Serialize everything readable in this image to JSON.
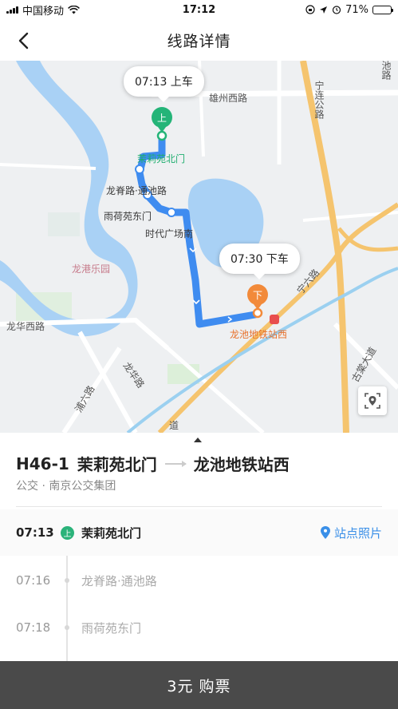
{
  "status_bar": {
    "carrier": "中国移动",
    "time": "17:12",
    "battery": "71%",
    "battery_level": 0.71
  },
  "nav": {
    "title": "线路详情",
    "back_icon": "chevron-left-icon"
  },
  "map": {
    "board_bubble": "07:13 上车",
    "alight_bubble": "07:30 下车",
    "board_pin": "上",
    "alight_pin": "下",
    "labels": {
      "xiongzhou_road": "雄州西路",
      "ninglian_road": "宁连公路",
      "chi_top": "池路",
      "molly_north_gate": "茉莉苑北门",
      "longji_tongchi": "龙脊路·通池路",
      "yuhe_east": "雨荷苑东门",
      "shidai_south": "时代广场南",
      "longgang_park": "龙港乐园",
      "ningliu_road": "宁六路",
      "longhua_west": "龙华西路",
      "longchi_station": "龙池地铁站西",
      "longhua_road": "龙华路",
      "puliu_road": "浦六路",
      "gutang_avenue": "古棠大道",
      "dao": "道"
    },
    "route_color": "#3f8cf0",
    "locate_icon": "locate-icon"
  },
  "sheet": {
    "route_number": "H46-1",
    "from": "茉莉苑北门",
    "to": "龙池地铁站西",
    "subtitle": "公交 · 南京公交集团",
    "photo_link": "站点照片",
    "stops": [
      {
        "time": "07:13",
        "name": "茉莉苑北门",
        "badge": "上"
      },
      {
        "time": "07:16",
        "name": "龙脊路·通池路"
      },
      {
        "time": "07:18",
        "name": "雨荷苑东门"
      }
    ]
  },
  "buy_button": "3元 购票"
}
